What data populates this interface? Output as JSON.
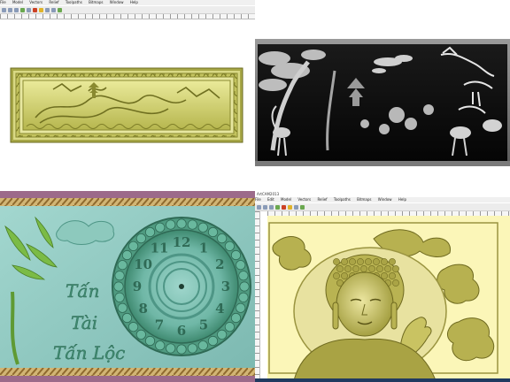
{
  "q1": {
    "menu": [
      "File",
      "Model",
      "Vectors",
      "Relief",
      "Toolpaths",
      "Bitmaps",
      "Window",
      "Help"
    ],
    "colors": {
      "relief": "#c7c76a",
      "relief_dark": "#7d7d2a",
      "border": "#e8e89c"
    }
  },
  "q2": {
    "colors": {
      "relief_light": "#d6d6d6",
      "relief_dark": "#141414"
    }
  },
  "q3": {
    "clock_numerals": [
      "12",
      "1",
      "2",
      "3",
      "4",
      "5",
      "6",
      "7",
      "8",
      "9",
      "10",
      "11"
    ],
    "calligraphy": [
      "Tấn",
      "Tài",
      "Tấn Lộc"
    ],
    "colors": {
      "bg": "#8fc9c2",
      "clock": "#3f8a70",
      "rope": "#b9924a",
      "bamboo": "#6aa63a"
    }
  },
  "q4": {
    "window_title": "ArtCAM2013",
    "menu": [
      "File",
      "Edit",
      "Model",
      "Vectors",
      "Relief",
      "Toolpaths",
      "Bitmaps",
      "Window",
      "Help"
    ],
    "colors": {
      "relief": "#c6c058",
      "bg": "#fbf6b8"
    }
  }
}
